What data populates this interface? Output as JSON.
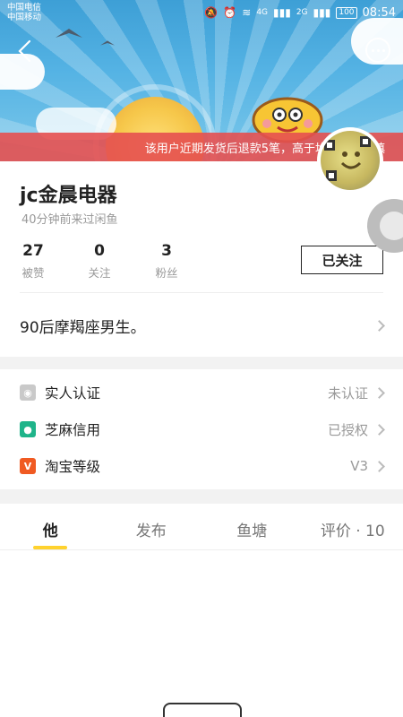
{
  "status_bar": {
    "carrier_1": "中国电信",
    "carrier_2": "中国移动",
    "network": "4G",
    "network_2": "2G",
    "battery": "100",
    "time": "08:54"
  },
  "notice": {
    "text": "该用户近期发货后退款5笔，高于均值，请谨慎"
  },
  "profile": {
    "name": "jc金晨电器",
    "last_seen": "40分钟前来过闲鱼",
    "follow_button": "已关注",
    "bio": "90后摩羯座男生。"
  },
  "stats": [
    {
      "num": "27",
      "label": "被赞"
    },
    {
      "num": "0",
      "label": "关注"
    },
    {
      "num": "3",
      "label": "粉丝"
    }
  ],
  "verification": [
    {
      "label": "实人认证",
      "value": "未认证",
      "icon": "id-verify-icon",
      "color": "#c9c9c9"
    },
    {
      "label": "芝麻信用",
      "value": "已授权",
      "icon": "sesame-credit-icon",
      "color": "#1fb48a"
    },
    {
      "label": "淘宝等级",
      "value": "V3",
      "icon": "taobao-level-icon",
      "color": "#f05a22"
    }
  ],
  "tabs": [
    {
      "label": "他",
      "active": true
    },
    {
      "label": "发布",
      "active": false
    },
    {
      "label": "鱼塘",
      "active": false
    },
    {
      "label": "评价 · 10",
      "active": false
    }
  ],
  "colors": {
    "notice_bg": "#e65050",
    "tab_underline": "#ffd22e",
    "banner_sky": "#4aa8dc"
  }
}
